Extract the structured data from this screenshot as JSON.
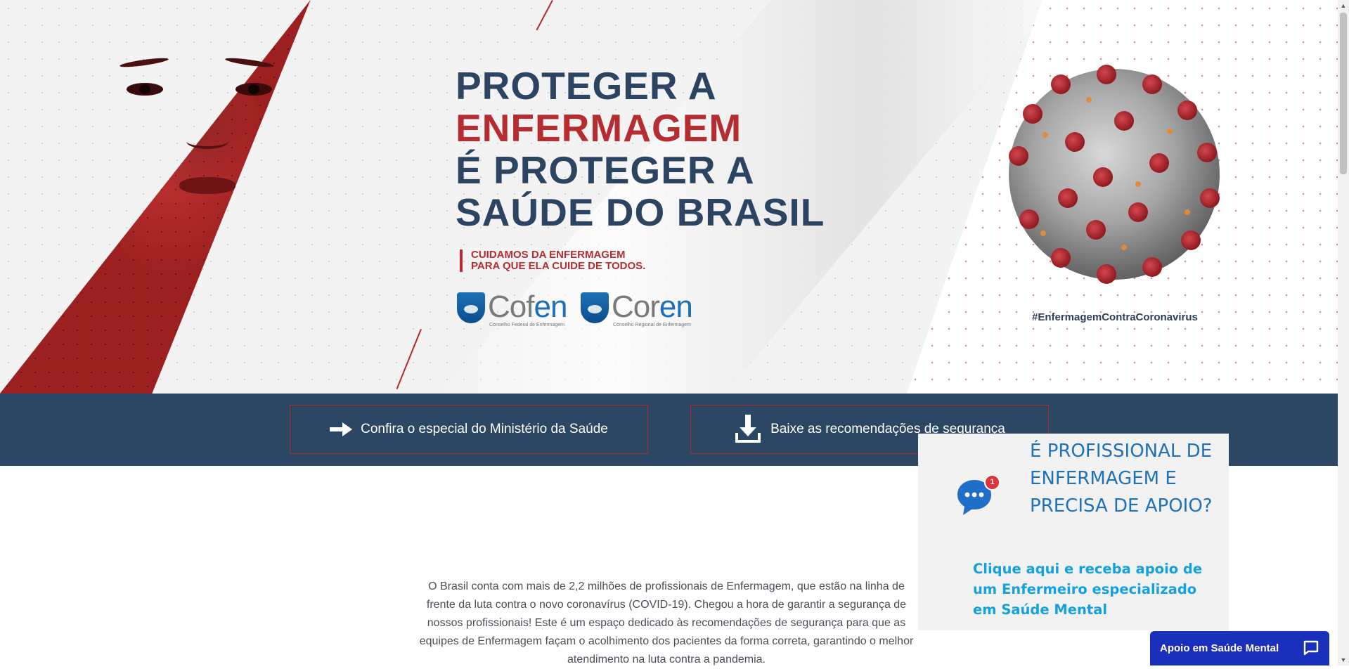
{
  "hero": {
    "headline_line1": "PROTEGER A",
    "headline_line2": "ENFERMAGEM",
    "headline_line3": "É PROTEGER A",
    "headline_line4": "SAÚDE DO BRASIL",
    "tagline_line1": "CUIDAMOS DA ENFERMAGEM",
    "tagline_line2": "PARA QUE ELA CUIDE DE TODOS.",
    "logos": [
      {
        "name_part1": "Cof",
        "name_part2": "en",
        "subtitle": "Conselho Federal de Enfermagem"
      },
      {
        "name_part1": "Cor",
        "name_part2": "en",
        "subtitle": "Conselho Regional de Enfermagem"
      }
    ],
    "hashtag": "#EnfermagemContraCoronavirus",
    "colors": {
      "navy": "#2b4462",
      "red": "#b52d30"
    }
  },
  "nav": {
    "ministerio_label": "Confira o especial do Ministério da Saúde",
    "ministerio_icon": "arrow-right-icon",
    "recomendacoes_label": "Baixe as recomendações de segurança",
    "recomendacoes_icon": "download-icon",
    "bar_color": "#2c4763"
  },
  "intro": {
    "text": "O Brasil conta com mais de 2,2 milhões de profissionais de Enfermagem, que estão na linha de frente da luta contra o novo coronavírus (COVID-19). Chegou a hora de garantir a segurança de nossos profissionais! Este é um espaço dedicado às recomendações de segurança para que as equipes de Enfermagem façam o acolhimento dos pacientes da forma correta, garantindo o melhor atendimento na luta contra a pandemia."
  },
  "support_popup": {
    "title": "É PROFISSIONAL DE ENFERMAGEM E PRECISA DE APOIO?",
    "subtitle": "Clique aqui e receba apoio de um Enfermeiro especializado em Saúde Mental",
    "badge_count": "1",
    "icon": "chat-bubble-icon"
  },
  "chat_widget": {
    "label": "Apoio em Saúde Mental",
    "icon": "chat-icon",
    "color": "#1a2fbc"
  }
}
